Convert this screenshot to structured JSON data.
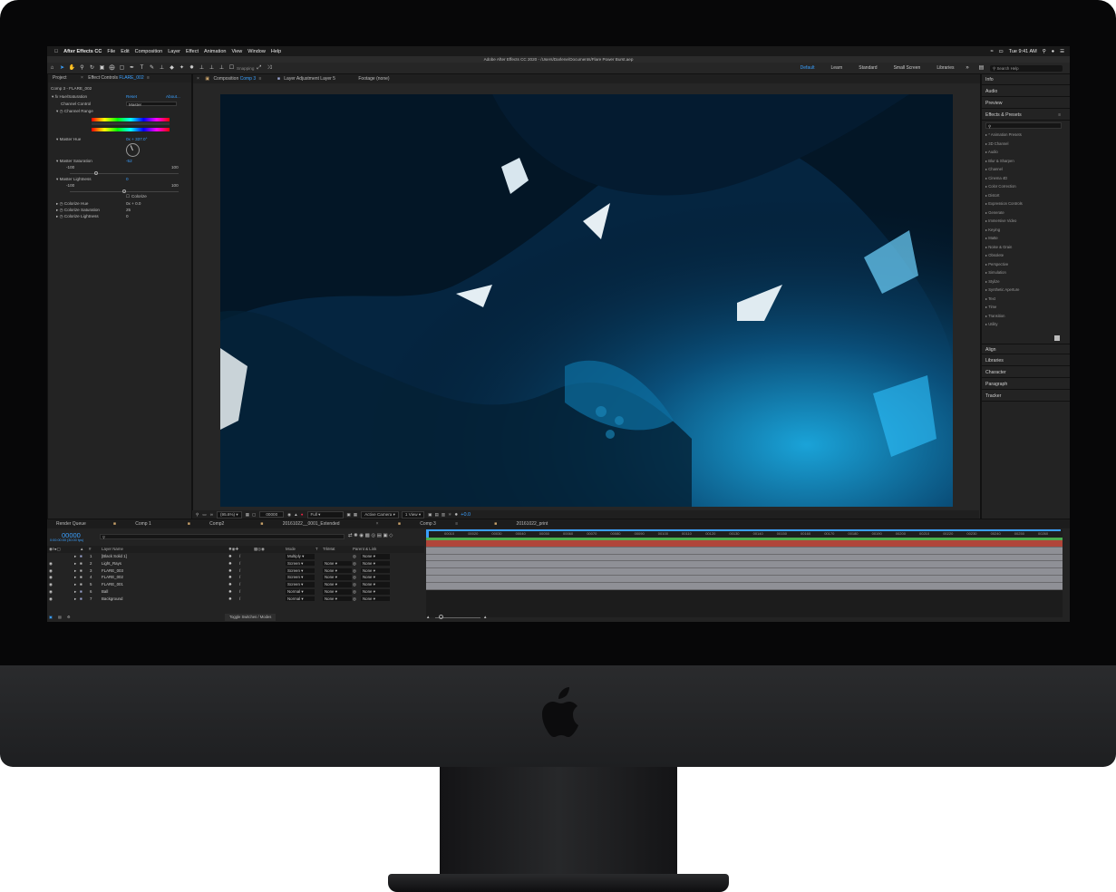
{
  "menubar": {
    "apple_icon": "apple-icon",
    "items": [
      "After Effects CC",
      "File",
      "Edit",
      "Composition",
      "Layer",
      "Effect",
      "Animation",
      "View",
      "Window",
      "Help"
    ],
    "clock": "Tue 9:41 AM"
  },
  "titlebar": {
    "title": "Adobe After Effects CC 2020 - /Users/Darlene/Documents/Flare Power Burst.aep"
  },
  "toolbar": {
    "snapping": "Snapping",
    "workspaces": [
      "Default",
      "Learn",
      "Standard",
      "Small Screen",
      "Libraries"
    ],
    "active_workspace": "Default",
    "search_placeholder": "Search Help"
  },
  "effect_controls": {
    "tab_project": "Project",
    "tab_label": "Effect Controls",
    "tab_layer": "FLARE_002",
    "breadcrumb": "Comp 3 - FLARE_002",
    "effect_name": "Hue/Saturation",
    "reset": "Reset",
    "about": "About...",
    "channel_control_label": "Channel Control",
    "channel_control_value": "Master",
    "channel_range": "Channel Range",
    "master_hue_label": "Master Hue",
    "master_hue_value": "0x + 337.0°",
    "master_saturation_label": "Master Saturation",
    "master_saturation_value": "-52",
    "sat_min": "-100",
    "sat_max": "100",
    "master_lightness_label": "Master Lightness",
    "master_lightness_value": "0",
    "light_min": "-100",
    "light_max": "100",
    "colorize": "Colorize",
    "colorize_hue_label": "Colorize Hue",
    "colorize_hue_value": "0x + 0.0",
    "colorize_saturation_label": "Colorize Saturation",
    "colorize_saturation_value": "25",
    "colorize_lightness_label": "Colorize Lightness",
    "colorize_lightness_value": "0"
  },
  "composition": {
    "tab_comp_prefix": "Composition",
    "tab_comp_name": "Comp 3",
    "tab_layer": "Layer Adjustment Layer 5",
    "tab_footage": "Footage (none)"
  },
  "viewer_footer": {
    "zoom": "(95.6%)",
    "timecode": "00000",
    "resolution": "Full",
    "camera": "Active Camera",
    "views": "1 View",
    "exposure": "+0.0"
  },
  "right_panels": {
    "info": "Info",
    "audio": "Audio",
    "preview": "Preview",
    "effects_presets": "Effects & Presets",
    "fx_categories": [
      "* Animation Presets",
      "3D Channel",
      "Audio",
      "Blur & Sharpen",
      "Channel",
      "Cinema 4D",
      "Color Correction",
      "Distort",
      "Expression Controls",
      "Generate",
      "Immersive Video",
      "Keying",
      "Matte",
      "Noise & Grain",
      "Obsolete",
      "Perspective",
      "Simulation",
      "Stylize",
      "Synthetic Aperture",
      "Text",
      "Time",
      "Transition",
      "Utility"
    ],
    "align": "Align",
    "libraries": "Libraries",
    "character": "Character",
    "paragraph": "Paragraph",
    "tracker": "Tracker"
  },
  "timeline": {
    "tabs": [
      "Render Queue",
      "Comp 1",
      "Comp2",
      "20161022__0001_Extended",
      "Comp 3",
      "20161022_print"
    ],
    "active_tab": "Comp 3",
    "timecode": "00000",
    "timecode_sub": "0:00:00:00 (30.00 fps)",
    "columns": {
      "layer_name": "Layer Name",
      "mode": "Mode",
      "t": "T",
      "trkmat": "TrkMat",
      "parent": "Parent & Link"
    },
    "layers": [
      {
        "num": "1",
        "name": "[Black Solid 1]",
        "mode": "Multiply",
        "trkmat": "",
        "parent": "None"
      },
      {
        "num": "2",
        "name": "Light_Rays",
        "mode": "Screen",
        "trkmat": "None",
        "parent": "None"
      },
      {
        "num": "3",
        "name": "FLARE_003",
        "mode": "Screen",
        "trkmat": "None",
        "parent": "None"
      },
      {
        "num": "4",
        "name": "FLARE_002",
        "mode": "Screen",
        "trkmat": "None",
        "parent": "None"
      },
      {
        "num": "5",
        "name": "FLARE_001",
        "mode": "Screen",
        "trkmat": "None",
        "parent": "None"
      },
      {
        "num": "6",
        "name": "Ball",
        "mode": "Normal",
        "trkmat": "None",
        "parent": "None"
      },
      {
        "num": "7",
        "name": "Background",
        "mode": "Normal",
        "trkmat": "None",
        "parent": "None"
      }
    ],
    "ruler": [
      "00010",
      "00020",
      "00030",
      "00040",
      "00050",
      "00060",
      "00070",
      "00080",
      "00090",
      "00100",
      "00110",
      "00120",
      "00130",
      "00140",
      "00150",
      "00160",
      "00170",
      "00180",
      "00190",
      "00200",
      "00210",
      "00220",
      "00230",
      "00240",
      "00250",
      "00260"
    ],
    "toggle": "Toggle Switches / Modes",
    "colors": {
      "accent": "#3aa0ff",
      "work_area_green": "#4caf50",
      "solid_track": "#b0453a",
      "layer_track": "#8f9096"
    }
  }
}
